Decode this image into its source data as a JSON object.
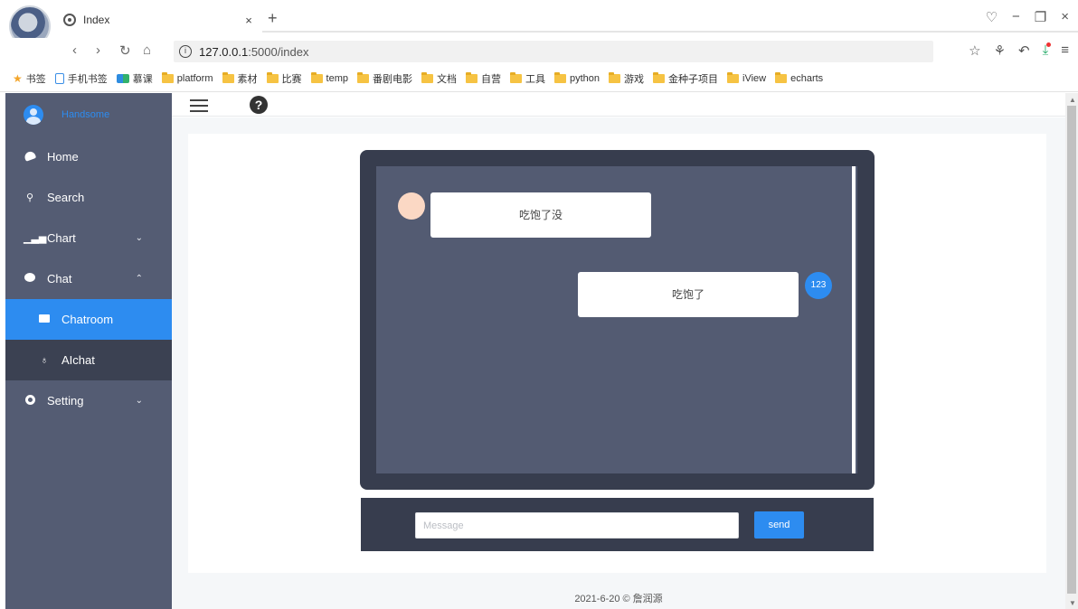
{
  "browser": {
    "tab_title": "Index",
    "tab_close": "×",
    "new_tab": "+",
    "url_host": "127.0.0.1",
    "url_path": ":5000/index",
    "nav": {
      "back": "‹",
      "forward": "›",
      "reload": "↻",
      "home": "⌂"
    },
    "window": {
      "minimize": "−",
      "maximize": "❐",
      "close": "×"
    }
  },
  "bookmarks": {
    "root": "书签",
    "items": [
      {
        "label": "手机书签",
        "icon": "phone-icon"
      },
      {
        "label": "慕课",
        "icon": "mooc-icon"
      },
      {
        "label": "platform",
        "icon": "folder-icon"
      },
      {
        "label": "素材",
        "icon": "folder-icon"
      },
      {
        "label": "比赛",
        "icon": "folder-icon"
      },
      {
        "label": "temp",
        "icon": "folder-icon"
      },
      {
        "label": "番剧电影",
        "icon": "folder-icon"
      },
      {
        "label": "文档",
        "icon": "folder-icon"
      },
      {
        "label": "自营",
        "icon": "folder-icon"
      },
      {
        "label": "工具",
        "icon": "folder-icon"
      },
      {
        "label": "python",
        "icon": "folder-icon"
      },
      {
        "label": "游戏",
        "icon": "folder-icon"
      },
      {
        "label": "金种子项目",
        "icon": "folder-icon"
      },
      {
        "label": "iView",
        "icon": "folder-icon"
      },
      {
        "label": "echarts",
        "icon": "folder-icon"
      }
    ]
  },
  "sidebar": {
    "user_name": "Handsome",
    "items": [
      {
        "label": "Home",
        "icon": "home-icon"
      },
      {
        "label": "Search",
        "icon": "search-icon"
      },
      {
        "label": "Chart",
        "icon": "chart-icon",
        "chevron": "⌄"
      },
      {
        "label": "Chat",
        "icon": "chat-icon",
        "chevron": "⌃"
      },
      {
        "label": "Chatroom",
        "icon": "chatroom-icon",
        "active": true
      },
      {
        "label": "AIchat",
        "icon": "bot-icon"
      },
      {
        "label": "Setting",
        "icon": "gear-icon",
        "chevron": "⌄"
      }
    ]
  },
  "header": {
    "help_label": "?"
  },
  "chat": {
    "messages": [
      {
        "side": "left",
        "text": "吃饱了没"
      },
      {
        "side": "right",
        "text": "吃饱了",
        "avatar_text": "123"
      }
    ],
    "input_placeholder": "Message",
    "send_label": "send"
  },
  "footer": {
    "text": "2021-6-20 © 詹润源"
  },
  "colors": {
    "sidebar": "#545c73",
    "submenu": "#3b4152",
    "accent": "#2d8cf0",
    "chat_frame": "#373d4e",
    "chat_area": "#535b72"
  }
}
